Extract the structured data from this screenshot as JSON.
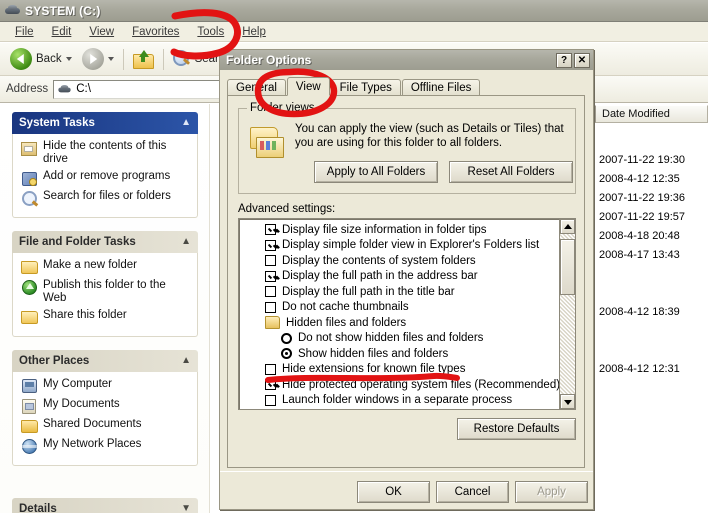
{
  "window": {
    "title": "SYSTEM (C:)",
    "drive_icon": "drive-icon",
    "menu": [
      {
        "label": "File"
      },
      {
        "label": "Edit"
      },
      {
        "label": "View"
      },
      {
        "label": "Favorites"
      },
      {
        "label": "Tools"
      },
      {
        "label": "Help"
      }
    ],
    "toolbar": {
      "back_label": "Back",
      "back_icon": "back-arrow-icon",
      "forward_icon": "forward-arrow-icon",
      "up_icon": "up-folder-icon",
      "search_label": "Searc",
      "search_icon": "search-icon"
    },
    "address": {
      "label": "Address",
      "value": "C:\\",
      "icon": "drive-icon"
    }
  },
  "sidebar": {
    "groups": [
      {
        "title": "System Tasks",
        "style": "blue",
        "collapse_icon": "chevron-up-icon",
        "items": [
          {
            "label": "Hide the contents of this drive",
            "icon": "hide-drive-icon"
          },
          {
            "label": "Add or remove programs",
            "icon": "add-remove-programs-icon"
          },
          {
            "label": "Search for files or folders",
            "icon": "search-icon"
          }
        ]
      },
      {
        "title": "File and Folder Tasks",
        "style": "grey",
        "collapse_icon": "chevron-up-icon",
        "items": [
          {
            "label": "Make a new folder",
            "icon": "new-folder-icon"
          },
          {
            "label": "Publish this folder to the Web",
            "icon": "publish-web-icon"
          },
          {
            "label": "Share this folder",
            "icon": "share-folder-icon"
          }
        ]
      },
      {
        "title": "Other Places",
        "style": "grey",
        "collapse_icon": "chevron-up-icon",
        "items": [
          {
            "label": "My Computer",
            "icon": "my-computer-icon"
          },
          {
            "label": "My Documents",
            "icon": "my-documents-icon"
          },
          {
            "label": "Shared Documents",
            "icon": "shared-documents-icon"
          },
          {
            "label": "My Network Places",
            "icon": "my-network-places-icon"
          }
        ]
      },
      {
        "title": "Details",
        "style": "grey",
        "collapse_icon": "chevron-down-icon",
        "items": []
      }
    ]
  },
  "filelist": {
    "column_header": "Date Modified",
    "rows": [
      {
        "date": "2007-11-22 19:30"
      },
      {
        "date": "2008-4-12 12:35"
      },
      {
        "date": "2007-11-22 19:36"
      },
      {
        "date": "2007-11-22 19:57"
      },
      {
        "date": "2008-4-18 20:48"
      },
      {
        "date": "2008-4-17 13:43"
      },
      {
        "date": ""
      },
      {
        "date": ""
      },
      {
        "date": "2008-4-12 18:39"
      },
      {
        "date": ""
      },
      {
        "date": ""
      },
      {
        "date": "2008-4-12 12:31"
      }
    ]
  },
  "dialog": {
    "title": "Folder Options",
    "help_button": "?",
    "close_button": "✕",
    "tabs": [
      {
        "label": "General",
        "active": false
      },
      {
        "label": "View",
        "active": true
      },
      {
        "label": "File Types",
        "active": false
      },
      {
        "label": "Offline Files",
        "active": false
      }
    ],
    "folder_views": {
      "legend": "Folder views",
      "icon": "folder-views-icon",
      "description": "You can apply the view (such as Details or Tiles) that you are using for this folder to all folders.",
      "apply_all_label": "Apply to All Folders",
      "reset_all_label": "Reset All Folders"
    },
    "advanced": {
      "label": "Advanced settings:",
      "scrollbar": {
        "up_icon": "scroll-up-icon",
        "down_icon": "scroll-down-icon"
      },
      "items": [
        {
          "type": "checkbox",
          "checked": true,
          "indent": 0,
          "label": "Display file size information in folder tips"
        },
        {
          "type": "checkbox",
          "checked": true,
          "indent": 0,
          "label": "Display simple folder view in Explorer's Folders list"
        },
        {
          "type": "checkbox",
          "checked": false,
          "indent": 0,
          "label": "Display the contents of system folders"
        },
        {
          "type": "checkbox",
          "checked": true,
          "indent": 0,
          "label": "Display the full path in the address bar"
        },
        {
          "type": "checkbox",
          "checked": false,
          "indent": 0,
          "label": "Display the full path in the title bar"
        },
        {
          "type": "checkbox",
          "checked": false,
          "indent": 0,
          "label": "Do not cache thumbnails"
        },
        {
          "type": "folder",
          "checked": false,
          "indent": 0,
          "label": "Hidden files and folders"
        },
        {
          "type": "radio",
          "checked": false,
          "indent": 1,
          "label": "Do not show hidden files and folders"
        },
        {
          "type": "radio",
          "checked": true,
          "indent": 1,
          "label": "Show hidden files and folders"
        },
        {
          "type": "checkbox",
          "checked": false,
          "indent": 0,
          "label": "Hide extensions for known file types",
          "struck": true
        },
        {
          "type": "checkbox",
          "checked": true,
          "indent": 0,
          "label": "Hide protected operating system files (Recommended)"
        },
        {
          "type": "checkbox",
          "checked": false,
          "indent": 0,
          "label": "Launch folder windows in a separate process"
        }
      ]
    },
    "restore_defaults_label": "Restore Defaults",
    "footer": {
      "ok_label": "OK",
      "cancel_label": "Cancel",
      "apply_label": "Apply",
      "apply_disabled": true
    }
  },
  "annotations": {
    "color": "#e21313",
    "marks": [
      {
        "name": "circle-tools-menu",
        "shape": "circle"
      },
      {
        "name": "circle-view-tab",
        "shape": "circle"
      },
      {
        "name": "strikethrough-hide-extensions",
        "shape": "line"
      }
    ]
  }
}
